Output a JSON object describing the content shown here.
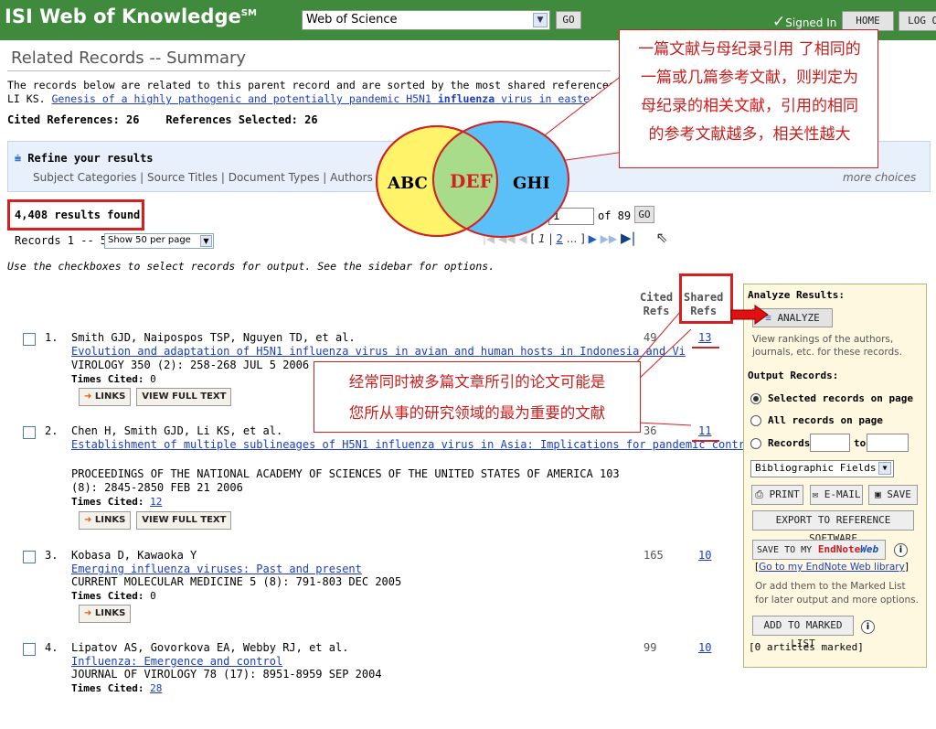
{
  "header": {
    "logo": "ISI Web of Knowledge",
    "logo_sup": "SM",
    "database": "Web of Science",
    "go": "GO",
    "signed_in": "Signed In",
    "home": "HOME",
    "logout": "LOG OU"
  },
  "page": {
    "title": "Related Records -- Summary",
    "intro_line1": "The records below are related to this parent record and are sorted by the most shared references:",
    "intro_author": "LI KS.",
    "intro_link_a": "Genesis of a highly pathogenic and potentially pandemic H5N1",
    "intro_link_b": "influenza",
    "intro_link_c": "virus in eastern Asia",
    "cited_refs": "Cited References: 26",
    "refs_selected": "References Selected: 26"
  },
  "refine": {
    "title": "Refine your results",
    "links": "Subject Categories | Source Titles | Document Types | Authors",
    "more": "more choices"
  },
  "results": {
    "found": "4,408 results found",
    "records": "Records 1 -- 50",
    "show": "Show 50 per page",
    "page_value": "1",
    "of_pages": "of 89",
    "go": "GO",
    "pager_bracket_open": "[",
    "pager_current": "1",
    "pager_sep": "|",
    "pager_next": "2",
    "pager_more": "...",
    "pager_bracket_close": "]",
    "use_checkboxes": "Use the checkboxes to select records for output. See the sidebar for options."
  },
  "columns": {
    "cited_1": "Cited",
    "cited_2": "Refs",
    "shared_1": "Shared",
    "shared_2": "Refs"
  },
  "records": [
    {
      "num": "1.",
      "authors": "Smith GJD, Naipospos TSP, Nguyen TD, et al.",
      "title": "Evolution and adaptation of H5N1 influenza virus in avian and human hosts in Indonesia and Vi",
      "source": "VIROLOGY 350 (2): 258-268 JUL 5 2006",
      "times_cited_label": "Times Cited:",
      "times_cited": "0",
      "links": "LINKS",
      "full_text": "VIEW FULL TEXT",
      "cited": "49",
      "shared": "13"
    },
    {
      "num": "2.",
      "authors": "Chen H, Smith GJD, Li KS, et al.",
      "title": "Establishment of multiple sublineages of H5N1 influenza virus in Asia: Implications for pandemic control",
      "source": "PROCEEDINGS OF THE NATIONAL ACADEMY OF SCIENCES OF THE UNITED STATES OF AMERICA 103",
      "source2": "(8): 2845-2850 FEB 21 2006",
      "times_cited_label": "Times Cited:",
      "times_cited": "12",
      "links": "LINKS",
      "full_text": "VIEW FULL TEXT",
      "cited": "36",
      "shared": "11"
    },
    {
      "num": "3.",
      "authors": "Kobasa D, Kawaoka Y",
      "title": "Emerging influenza viruses: Past and present",
      "source": "CURRENT MOLECULAR MEDICINE 5 (8): 791-803 DEC 2005",
      "times_cited_label": "Times Cited:",
      "times_cited": "0",
      "links": "LINKS",
      "cited": "165",
      "shared": "10"
    },
    {
      "num": "4.",
      "authors": "Lipatov AS, Govorkova EA, Webby RJ, et al.",
      "title": "Influenza: Emergence and control",
      "source": "JOURNAL OF VIROLOGY 78 (17): 8951-8959 SEP 2004",
      "times_cited_label": "Times Cited:",
      "times_cited": "28",
      "cited": "99",
      "shared": "10"
    }
  ],
  "sidebar": {
    "analyze_title": "Analyze Results:",
    "analyze_btn": "ANALYZE",
    "analyze_desc": "View rankings of the authors, journals, etc. for these records.",
    "output_title": "Output Records:",
    "opt_selected": "Selected records on page",
    "opt_all": "All records on page",
    "opt_records": "Records",
    "to": "to",
    "bib_fields": "Bibliographic Fields",
    "print": "PRINT",
    "email": "E-MAIL",
    "save": "SAVE",
    "export": "EXPORT TO REFERENCE SOFTWARE",
    "save_to_my": "SAVE TO MY",
    "endnote": "EndNote",
    "web": "Web",
    "go_endnote": "Go to my EndNote Web library",
    "or_add": "Or add them to the Marked List for later output and more options.",
    "add_marked": "ADD TO MARKED LIST",
    "marked_count": "[0 articles marked]"
  },
  "annotations": {
    "callout1_a": "一篇文献与母纪录引用 了相同的",
    "callout1_b": "一篇或几篇参考文献，则判定为",
    "callout1_c1": "母纪录的",
    "callout1_c2": "相关文献",
    "callout1_c3": "，引用的相同",
    "callout1_d": "的参考文献越多，相关性越大",
    "callout2_a": "经常同时被多篇文章所引的论文可能是",
    "callout2_b": "您所从事的研究领域的最为重要的文献",
    "venn_left": "ABC",
    "venn_mid": "DEF",
    "venn_right": "GHI"
  },
  "colors": {
    "header_green": "#3f8a3c",
    "highlight_red": "#d42020",
    "link_blue": "#1a3cc8",
    "venn_yellow": "#fff36a",
    "venn_blue": "#5cc0f8",
    "venn_overlap": "#a8dc8a"
  }
}
